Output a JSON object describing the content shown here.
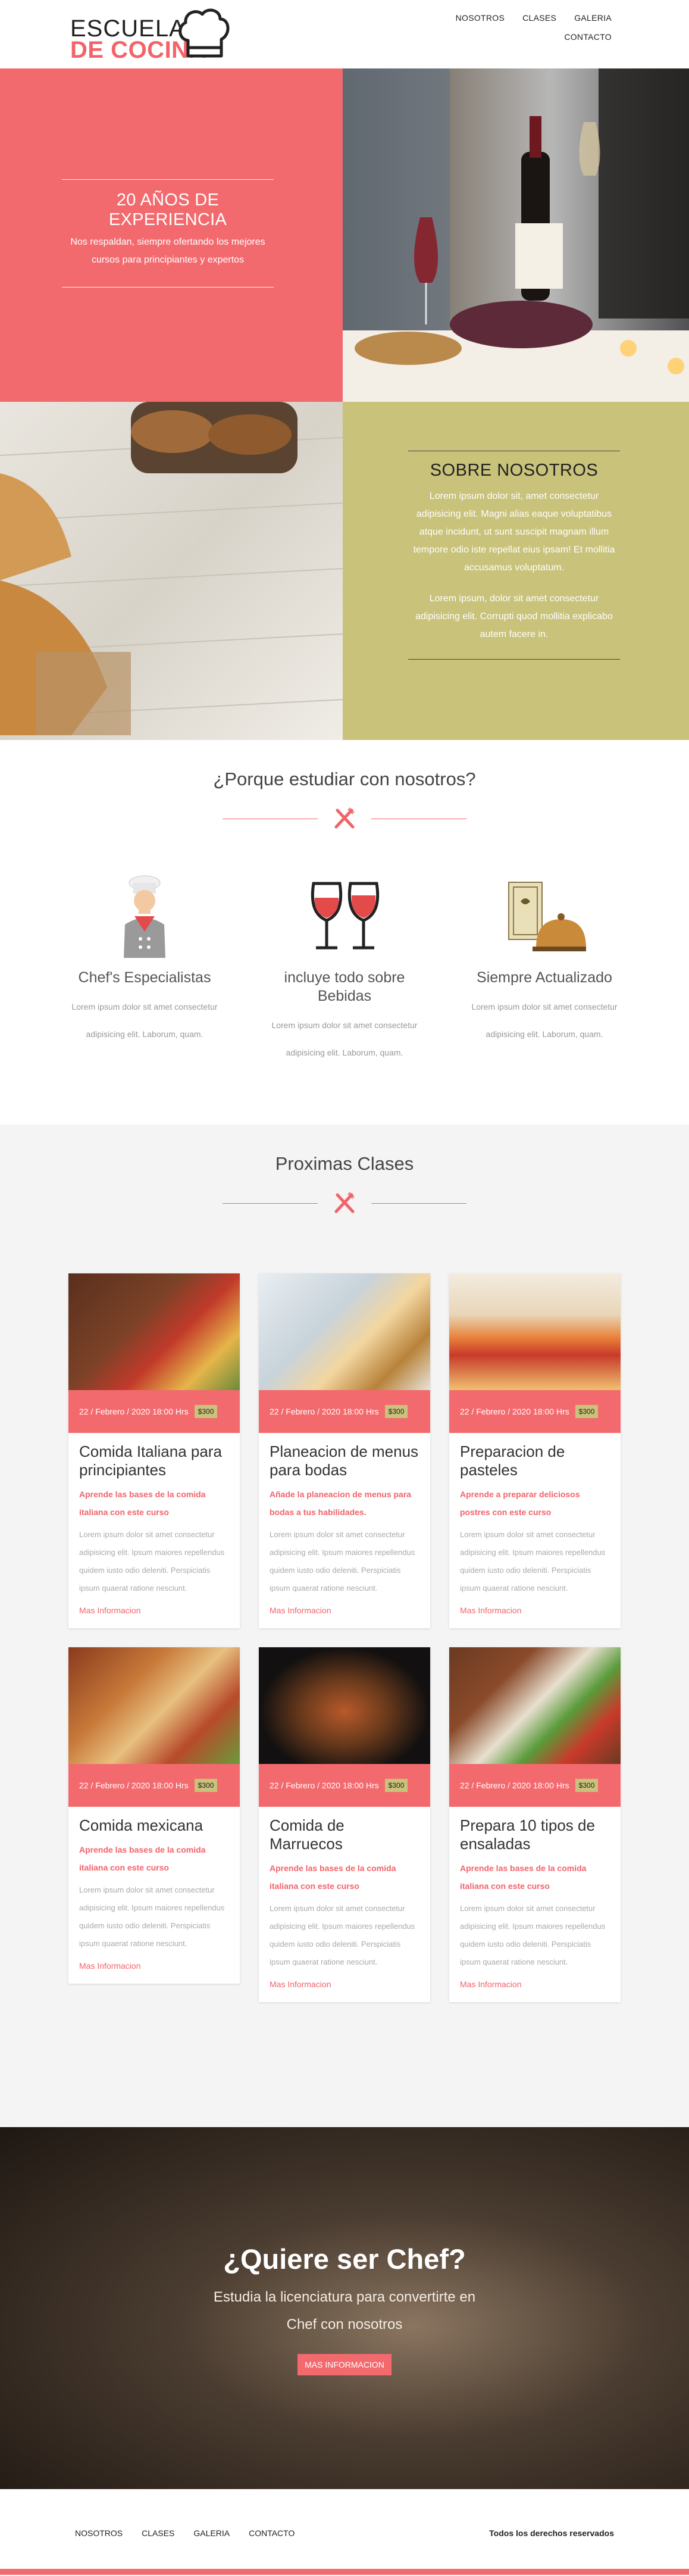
{
  "brand": {
    "line1": "ESCUELA",
    "line2": "DE COCINA",
    "icon": "chef-hat-icon"
  },
  "nav": [
    "NOSOTROS",
    "CLASES",
    "GALERIA",
    "CONTACTO"
  ],
  "hero": {
    "experience_title": "20 AÑOS DE EXPERIENCIA",
    "experience_text": "Nos respaldan, siempre ofertando los mejores cursos para principiantes y expertos",
    "about_title": "SOBRE NOSOTROS",
    "about_p1": "Lorem ipsum dolor sit, amet consectetur adipisicing elit. Magni alias eaque voluptatibus atque incidunt, ut sunt suscipit magnam illum tempore odio iste repellat eius ipsam! Et mollitia accusamus voluptatum.",
    "about_p2": "Lorem ipsum, dolor sit amet consectetur adipisicing elit. Corrupti quod mollitia explicabo autem facere in."
  },
  "why": {
    "title": "¿Porque estudiar con nosotros?",
    "features": [
      {
        "title": "Chef's Especialistas",
        "text": "Lorem ipsum dolor sit amet consectetur adipisicing elit. Laborum, quam.",
        "icon": "chef-icon"
      },
      {
        "title": "incluye todo sobre Bebidas",
        "text": "Lorem ipsum dolor sit amet consectetur adipisicing elit. Laborum, quam.",
        "icon": "wine-glasses-icon"
      },
      {
        "title": "Siempre Actualizado",
        "text": "Lorem ipsum dolor sit amet consectetur adipisicing elit. Laborum, quam.",
        "icon": "menu-cloche-icon"
      }
    ]
  },
  "classes": {
    "title": "Proximas Clases",
    "more_label": "Mas Informacion",
    "items": [
      {
        "date": "22 / Febrero / 2020 18:00 Hrs",
        "price": "$300",
        "title": "Comida Italiana para principiantes",
        "subtitle": "Aprende las bases de la comida italiana con este curso",
        "text": "Lorem ipsum dolor sit amet consectetur adipisicing elit. Ipsum maiores repellendus quidem iusto odio deleniti. Perspiciatis ipsum quaerat ratione nesciunt."
      },
      {
        "date": "22 / Febrero / 2020 18:00 Hrs",
        "price": "$300",
        "title": "Planeacion de menus para bodas",
        "subtitle": "Añade la planeacion de menus para bodas a tus habilidades.",
        "text": "Lorem ipsum dolor sit amet consectetur adipisicing elit. Ipsum maiores repellendus quidem iusto odio deleniti. Perspiciatis ipsum quaerat ratione nesciunt."
      },
      {
        "date": "22 / Febrero / 2020 18:00 Hrs",
        "price": "$300",
        "title": "Preparacion de pasteles",
        "subtitle": "Aprende a preparar deliciosos postres con este curso",
        "text": "Lorem ipsum dolor sit amet consectetur adipisicing elit. Ipsum maiores repellendus quidem iusto odio deleniti. Perspiciatis ipsum quaerat ratione nesciunt."
      },
      {
        "date": "22 / Febrero / 2020 18:00 Hrs",
        "price": "$300",
        "title": "Comida mexicana",
        "subtitle": "Aprende las bases de la comida italiana con este curso",
        "text": "Lorem ipsum dolor sit amet consectetur adipisicing elit. Ipsum maiores repellendus quidem iusto odio deleniti. Perspiciatis ipsum quaerat ratione nesciunt."
      },
      {
        "date": "22 / Febrero / 2020 18:00 Hrs",
        "price": "$300",
        "title": "Comida de Marruecos",
        "subtitle": "Aprende las bases de la comida italiana con este curso",
        "text": "Lorem ipsum dolor sit amet consectetur adipisicing elit. Ipsum maiores repellendus quidem iusto odio deleniti. Perspiciatis ipsum quaerat ratione nesciunt."
      },
      {
        "date": "22 / Febrero / 2020 18:00 Hrs",
        "price": "$300",
        "title": "Prepara 10 tipos de ensaladas",
        "subtitle": "Aprende las bases de la comida italiana con este curso",
        "text": "Lorem ipsum dolor sit amet consectetur adipisicing elit. Ipsum maiores repellendus quidem iusto odio deleniti. Perspiciatis ipsum quaerat ratione nesciunt."
      }
    ]
  },
  "cta": {
    "title": "¿Quiere ser Chef?",
    "text": "Estudia la licenciatura para convertirte en Chef con nosotros",
    "button": "MAS INFORMACION"
  },
  "footer": {
    "nav": [
      "NOSOTROS",
      "CLASES",
      "GALERIA",
      "CONTACTO"
    ],
    "rights": "Todos los derechos reservados"
  },
  "colors": {
    "accent": "#f36a6e",
    "olive": "#c9c27a",
    "light_bg": "#f4f4f4"
  }
}
